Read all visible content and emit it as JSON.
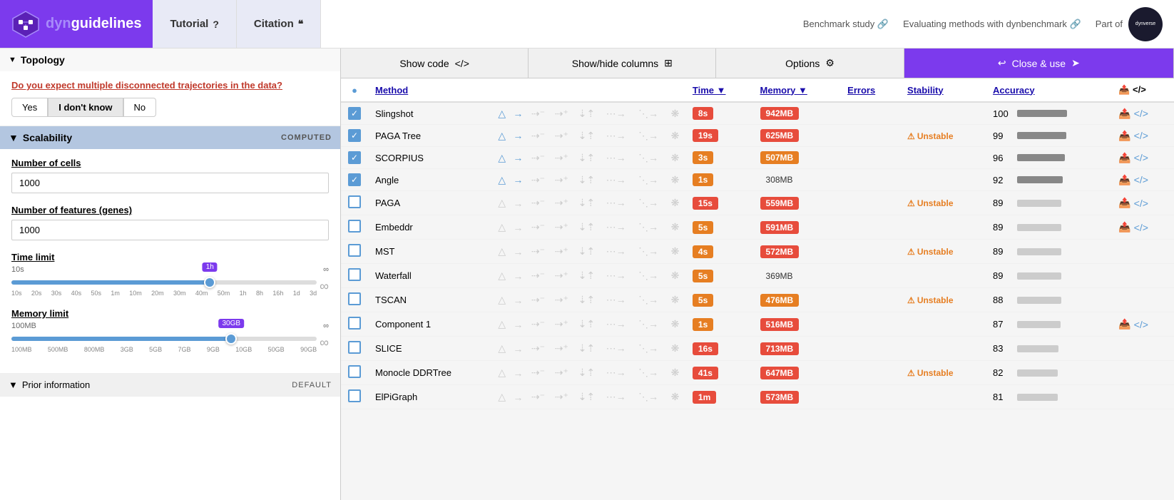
{
  "app": {
    "title": "dynguidelines",
    "title_prefix": "dyn",
    "title_suffix": "guidelines"
  },
  "nav": {
    "tutorial_label": "Tutorial",
    "tutorial_icon": "?",
    "citation_label": "Citation",
    "citation_icon": "❝"
  },
  "header_right": {
    "benchmark_label": "Benchmark study",
    "evaluating_label": "Evaluating methods with dynbenchmark",
    "part_of_label": "Part of",
    "dynverse_label": "dynverse"
  },
  "sidebar": {
    "topology_label": "Topology",
    "topology_arrow": "▼",
    "question": "Do you expect multiple disconnected trajectories in the data?",
    "buttons": [
      "Yes",
      "I don't know",
      "No"
    ],
    "active_button": "I don't know",
    "scalability_label": "Scalability",
    "scalability_arrow": "▼",
    "computed_label": "COMPUTED",
    "cells_label": "Number of cells",
    "cells_value": "1000",
    "genes_label": "Number of features (genes)",
    "genes_value": "1000",
    "time_limit_label": "Time limit",
    "time_min": "10s",
    "time_max": "∞",
    "time_value": "1h",
    "time_ticks": [
      "10s",
      "20s",
      "30s",
      "40s",
      "50s",
      "1m",
      "10m",
      "20m",
      "30m",
      "40m",
      "50m",
      "1h",
      "8h",
      "16h",
      "1d",
      "3d"
    ],
    "memory_limit_label": "Memory limit",
    "memory_min": "100MB",
    "memory_max": "∞",
    "memory_value": "30GB",
    "memory_ticks": [
      "100MB",
      "500MB",
      "800MB",
      "3GB",
      "5GB",
      "7GB",
      "9GB",
      "10GB",
      "50GB",
      "90GB"
    ],
    "prior_label": "Prior information",
    "prior_arrow": "▼",
    "default_label": "DEFAULT"
  },
  "toolbar": {
    "show_code_label": "Show code",
    "show_code_icon": "</>",
    "show_hide_label": "Show/hide columns",
    "show_hide_icon": "⊞",
    "options_label": "Options",
    "options_icon": "⚙",
    "close_label": "Close & use",
    "close_icon": "↩"
  },
  "table": {
    "col_status": "",
    "col_method": "Method",
    "col_time": "Time",
    "col_memory": "Memory",
    "col_errors": "Errors",
    "col_stability": "Stability",
    "col_accuracy": "Accuracy",
    "rows": [
      {
        "checked": true,
        "name": "Slingshot",
        "time": "8s",
        "time_class": "time-red",
        "memory": "942MB",
        "mem_class": "mem-red",
        "stability": "",
        "accuracy": 100,
        "acc_width": 100
      },
      {
        "checked": true,
        "name": "PAGA Tree",
        "time": "19s",
        "time_class": "time-red",
        "memory": "625MB",
        "mem_class": "mem-red",
        "stability": "Unstable",
        "accuracy": 99,
        "acc_width": 99
      },
      {
        "checked": true,
        "name": "SCORPIUS",
        "time": "3s",
        "time_class": "time-orange",
        "memory": "507MB",
        "mem_class": "mem-orange",
        "stability": "",
        "accuracy": 96,
        "acc_width": 96
      },
      {
        "checked": true,
        "name": "Angle",
        "time": "1s",
        "time_class": "time-orange",
        "memory": "308MB",
        "mem_class": "mem-normal",
        "stability": "",
        "accuracy": 92,
        "acc_width": 92
      },
      {
        "checked": false,
        "name": "PAGA",
        "time": "15s",
        "time_class": "time-red",
        "memory": "559MB",
        "mem_class": "mem-red",
        "stability": "Unstable",
        "accuracy": 89,
        "acc_width": 89
      },
      {
        "checked": false,
        "name": "Embeddr",
        "time": "5s",
        "time_class": "time-orange",
        "memory": "591MB",
        "mem_class": "mem-red",
        "stability": "",
        "accuracy": 89,
        "acc_width": 89
      },
      {
        "checked": false,
        "name": "MST",
        "time": "4s",
        "time_class": "time-orange",
        "memory": "572MB",
        "mem_class": "mem-red",
        "stability": "Unstable",
        "accuracy": 89,
        "acc_width": 89
      },
      {
        "checked": false,
        "name": "Waterfall",
        "time": "5s",
        "time_class": "time-orange",
        "memory": "369MB",
        "mem_class": "mem-normal",
        "stability": "",
        "accuracy": 89,
        "acc_width": 89
      },
      {
        "checked": false,
        "name": "TSCAN",
        "time": "5s",
        "time_class": "time-orange",
        "memory": "476MB",
        "mem_class": "mem-orange",
        "stability": "Unstable",
        "accuracy": 88,
        "acc_width": 88
      },
      {
        "checked": false,
        "name": "Component 1",
        "time": "1s",
        "time_class": "time-orange",
        "memory": "516MB",
        "mem_class": "mem-red",
        "stability": "",
        "accuracy": 87,
        "acc_width": 87
      },
      {
        "checked": false,
        "name": "SLICE",
        "time": "16s",
        "time_class": "time-red",
        "memory": "713MB",
        "mem_class": "mem-red",
        "stability": "",
        "accuracy": 83,
        "acc_width": 83
      },
      {
        "checked": false,
        "name": "Monocle DDRTree",
        "time": "41s",
        "time_class": "time-red",
        "memory": "647MB",
        "mem_class": "mem-red",
        "stability": "Unstable",
        "accuracy": 82,
        "acc_width": 82
      },
      {
        "checked": false,
        "name": "ElPiGraph",
        "time": "1m",
        "time_class": "time-red",
        "memory": "573MB",
        "mem_class": "mem-red",
        "stability": "",
        "accuracy": 81,
        "acc_width": 81
      }
    ]
  }
}
